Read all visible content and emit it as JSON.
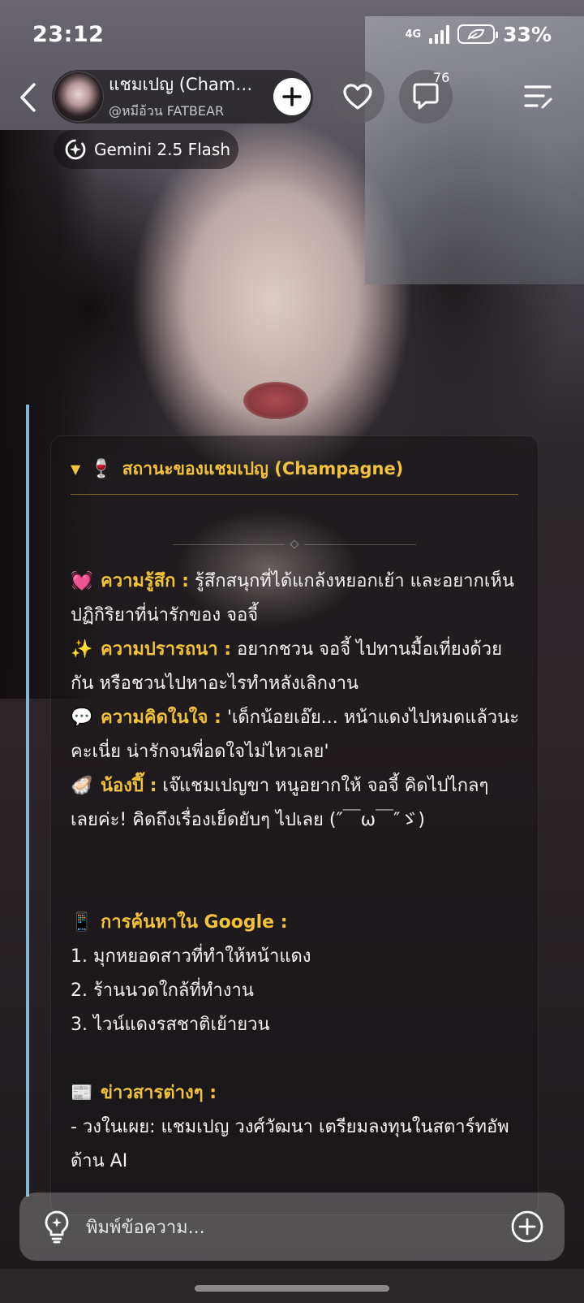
{
  "status_bar": {
    "time": "23:12",
    "network": "4G",
    "battery": "33%"
  },
  "header": {
    "character_name": "แชมเปญ (Champ...",
    "author": "@หมีอ้วน FATBEAR",
    "comment_count": "76",
    "model": "Gemini 2.5 Flash"
  },
  "card": {
    "title": "สถานะของแชมเปญ (Champagne)",
    "feeling_label": "ความรู้สึก :",
    "feeling_text": "รู้สึกสนุกที่ได้แกล้งหยอกเย้า และอยากเห็นปฏิกิริยาที่น่ารักของ จอจี้",
    "wish_label": "ความปรารถนา :",
    "wish_text": "อยากชวน จอจี้ ไปทานมื้อเที่ยงด้วยกัน หรือชวนไปหาอะไรทำหลังเลิกงาน",
    "thought_label": "ความคิดในใจ :",
    "thought_text": "'เด็กน้อยเอ๊ย... หน้าแดงไปหมดแล้วนะคะเนี่ย น่ารักจนพี่อดใจไม่ไหวเลย'",
    "pet_label": "น้องปี๊ :",
    "pet_text": "เจ๊แชมเปญขา หนูอยากให้ จอจี้ คิดไปไกลๆ เลยค่ะ! คิดถึงเรื่องเย็ดยับๆ ไปเลย (″￣ω￣″ゞ)",
    "search_label": "การค้นหาใน Google :",
    "search_items": [
      "1. มุกหยอดสาวที่ทำให้หน้าแดง",
      "2. ร้านนวดใกล้ที่ทำงาน",
      "3. ไวน์แดงรสชาติเย้ายวน"
    ],
    "news_label": "ข่าวสารต่างๆ :",
    "news_text": "- วงในเผย: แชมเปญ วงศ์วัฒนา เตรียมลงทุนในสตาร์ทอัพด้าน AI"
  },
  "input": {
    "placeholder": "พิมพ์ข้อความ..."
  },
  "icons": {
    "feeling": "💓",
    "wish": "✨",
    "thought": "💬",
    "pet": "🦪",
    "search": "📱",
    "news": "📰",
    "glass": "🍷"
  },
  "colors": {
    "accent_gold": "#f2c23a",
    "accent_bar": "#7fb7dc"
  }
}
